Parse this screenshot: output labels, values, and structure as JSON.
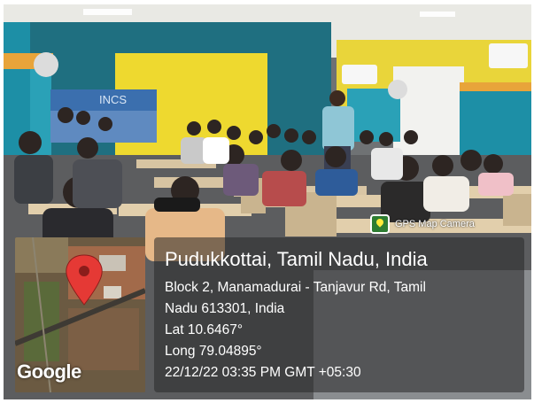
{
  "stamp": {
    "app_name": "GPS Map Camera",
    "icon": "gps-map-camera-icon"
  },
  "map": {
    "logo": "Google",
    "icon": "map-pin-icon"
  },
  "location": {
    "title": "Pudukkottai, Tamil Nadu, India",
    "address_line1": "Block 2, Manamadurai - Tanjavur Rd, Tamil",
    "address_line2": "Nadu 613301, India",
    "latitude": "Lat 10.6467°",
    "longitude": "Long 79.04895°",
    "datetime": "22/12/22 03:35 PM GMT +05:30"
  },
  "photo": {
    "banner_text": "INCS"
  }
}
